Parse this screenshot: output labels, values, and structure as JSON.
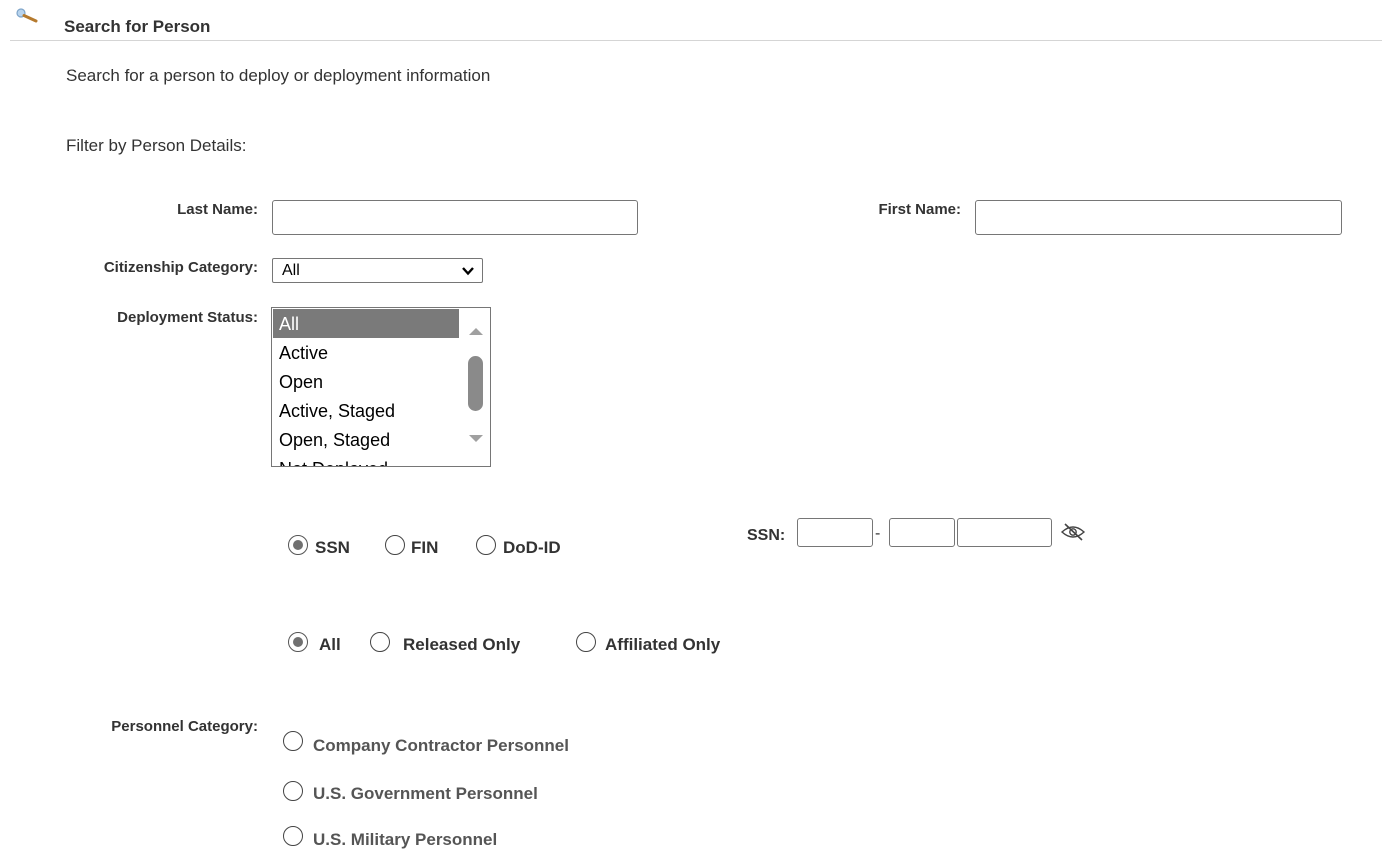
{
  "header": {
    "icon": "magnifier-icon",
    "title": "Search for Person"
  },
  "description": "Search for a person to deploy or deployment information",
  "filter_heading": "Filter by Person Details:",
  "fields": {
    "last_name": {
      "label": "Last Name:",
      "value": ""
    },
    "first_name": {
      "label": "First Name:",
      "value": ""
    },
    "citizenship": {
      "label": "Citizenship Category:",
      "selected": "All"
    },
    "deployment_status": {
      "label": "Deployment Status:",
      "options": [
        "All",
        "Active",
        "Open",
        "Active, Staged",
        "Open, Staged",
        "Not Deployed"
      ],
      "selected": "All"
    }
  },
  "id_type": {
    "options": [
      "SSN",
      "FIN",
      "DoD-ID"
    ],
    "selected": "SSN",
    "ssn_label": "SSN:",
    "ssn_parts": [
      "",
      "",
      ""
    ],
    "separator": "-",
    "visibility_icon": "eye-slash-icon"
  },
  "release_filter": {
    "options": [
      "All",
      "Released Only",
      "Affiliated Only"
    ],
    "selected": "All"
  },
  "personnel_category": {
    "label": "Personnel Category:",
    "options": [
      "Company Contractor Personnel",
      "U.S. Government Personnel",
      "U.S. Military Personnel"
    ],
    "selected": null
  },
  "colors": {
    "listbox_selected_bg": "#7a7a7a",
    "text": "#333333",
    "rule": "#d5d5d5"
  }
}
